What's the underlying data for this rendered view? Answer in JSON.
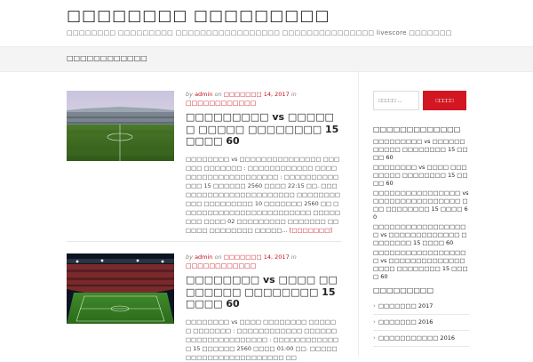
{
  "header": {
    "site_title": "□□□□□□□□ □□□□□□□□□",
    "site_description": "□□□□□□□□ □□□□□□□□□ □□□□□□□□□□□□□□□□□ □□□□□□□□□□□□□□□ livescore □□□□□□□"
  },
  "nav": {
    "items": [
      {
        "label": "□□□□□□□□□□□□"
      }
    ]
  },
  "posts": [
    {
      "meta": {
        "by": "by",
        "author": "admin",
        "on": "on",
        "date": "□□□□□□□ 14, 2017",
        "in": "in",
        "category": "□□□□□□□□□□□□"
      },
      "title": "□□□□□□□□□ vs □□□□□□ □□□□□ □□□□□□□□ 15 □□□□ 60",
      "excerpt": "□□□□□□□□ vs □□□□□□□□□□□□□□□ □□□□□□ □□□□□□□ : □□□□□□□□□□□□ □□□□□□□□□□□□□□□□□□□□□ : □□□□□□□□□□□□□ 15 □□□□□□ 2560 □□□□ 22:15 □□.  □□□□□□□□□□□□□□□□□□□□□□□ □□□□□□□□□□□ □□□□□□□□□ 10 □□□□□□□ 2560 □□ □□□□□□□□□□□□□□□□□□□□□□□□ □□□□□ □□□ □□□□ 02 □□□□□□□□□ □□□□□□□ □□□□□□ □□□□□□□□ □□□□□...",
      "read_more": "[□□□□□□□]"
    },
    {
      "meta": {
        "by": "by",
        "author": "admin",
        "on": "on",
        "date": "□□□□□□□ 14, 2017",
        "in": "in",
        "category": "□□□□□□□□□□□□"
      },
      "title": "□□□□□□□□ vs □□□□ □□□□□□□□ □□□□□□□□ 15 □□□□ 60",
      "excerpt": "□□□□□□□□ vs □□□□ □□□□□□□□ □□□□□□ □□□□□□□ : □□□□□□□□□□□□ □□□□□□□□□□□□□□□□□□□□□ : □□□□□□□□□□□□□ 15 □□□□□□ 2560 □□□□ 01:00 □□.  □□□□□□□□□□□□□□□□□□□□□□□ □□",
      "read_more": ""
    }
  ],
  "sidebar": {
    "search": {
      "placeholder": "□□□□□ ...",
      "button": "□□□□□"
    },
    "recent": {
      "title": "□□□□□□□□□□□□□",
      "items": [
        "□□□□□□□□□ vs □□□□□□ □□□□□ □□□□□□□□ 15 □□□□ 60",
        "□□□□□□□□ vs □□□□ □□□□□□□□ □□□□□□□□ 15 □□□□ 60",
        "□□□□□□□□□□□□□□□□ vs □□□□□□□□□□□□□□□□ □□□ □□□□□□□□ 15 □□□□ 60",
        "□□□□□□□□□□□□□□□□□□ vs □□□□□□□□□□□□□ □□□□□□□□ 15 □□□□ 60",
        "□□□□□□□□□□□□□□□□□□ vs □□□□□□□□□□□□□□□□□□ □□□□□□□□ 15 □□□□ 60"
      ]
    },
    "archive": {
      "title": "□□□□□□□□□",
      "items": [
        "□□□□□□□ 2017",
        "□□□□□□□ 2016",
        "□□□□□□□□□□□ 2016"
      ]
    }
  }
}
